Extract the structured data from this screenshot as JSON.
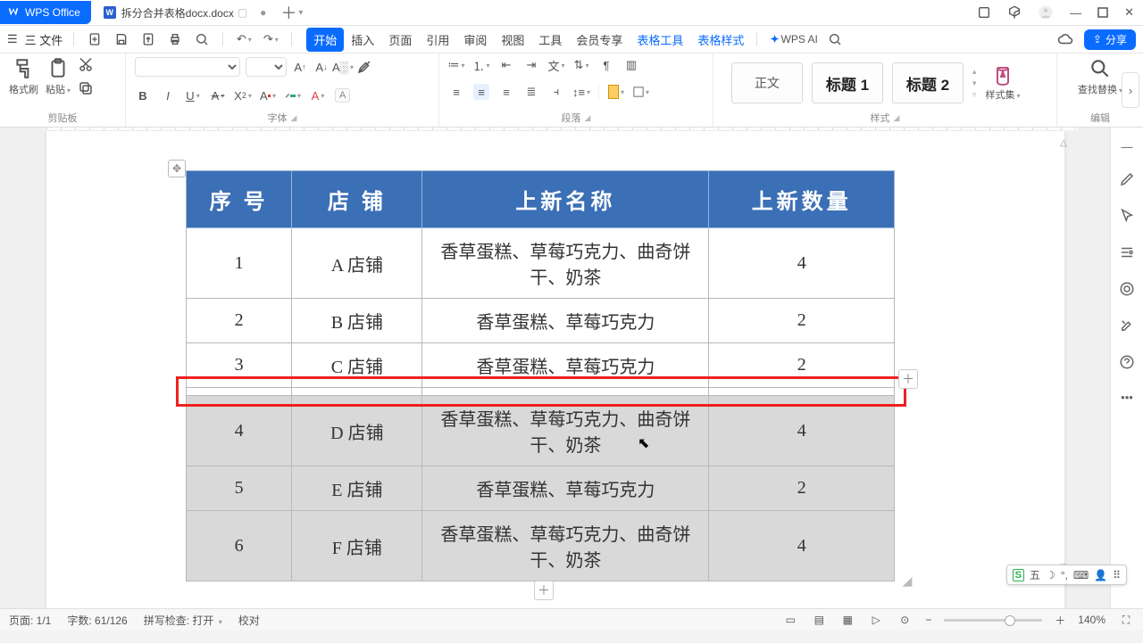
{
  "title": {
    "app": "WPS Office",
    "doc": "拆分合并表格docx.docx"
  },
  "menu": {
    "file": "三 文件",
    "items": [
      "开始",
      "插入",
      "页面",
      "引用",
      "审阅",
      "视图",
      "工具",
      "会员专享",
      "表格工具",
      "表格样式"
    ],
    "active_index": 0,
    "wpsai": "WPS AI",
    "share": "分享"
  },
  "ribbon": {
    "clipboard": {
      "format": "格式刷",
      "paste": "粘贴",
      "label": "剪贴板"
    },
    "font": {
      "label": "字体"
    },
    "paragraph": {
      "label": "段落"
    },
    "styles": {
      "normal": "正文",
      "h1": "标题 1",
      "h2": "标题 2",
      "lib": "样式集",
      "label": "样式"
    },
    "edit": {
      "find": "查找替换",
      "label": "编辑"
    }
  },
  "table": {
    "headers": [
      "序  号",
      "店  铺",
      "上新名称",
      "上新数量"
    ],
    "rows": [
      {
        "n": "1",
        "shop": "A 店铺",
        "items": "香草蛋糕、草莓巧克力、曲奇饼干、奶茶",
        "qty": "4",
        "sel": false
      },
      {
        "n": "2",
        "shop": "B 店铺",
        "items": "香草蛋糕、草莓巧克力",
        "qty": "2",
        "sel": false
      },
      {
        "n": "3",
        "shop": "C 店铺",
        "items": "香草蛋糕、草莓巧克力",
        "qty": "2",
        "sel": false
      },
      {
        "n": "",
        "shop": "",
        "items": "",
        "qty": "",
        "sel": false,
        "inserted": true
      },
      {
        "n": "4",
        "shop": "D 店铺",
        "items": "香草蛋糕、草莓巧克力、曲奇饼干、奶茶",
        "qty": "4",
        "sel": true
      },
      {
        "n": "5",
        "shop": "E 店铺",
        "items": "香草蛋糕、草莓巧克力",
        "qty": "2",
        "sel": true
      },
      {
        "n": "6",
        "shop": "F 店铺",
        "items": "香草蛋糕、草莓巧克力、曲奇饼干、奶茶",
        "qty": "4",
        "sel": true
      }
    ]
  },
  "status": {
    "page": "页面: 1/1",
    "words": "字数: 61/126",
    "spell": "拼写检查: 打开",
    "proof": "校对",
    "zoom": "140%"
  },
  "ime": {
    "brand": "S",
    "label": "五"
  }
}
